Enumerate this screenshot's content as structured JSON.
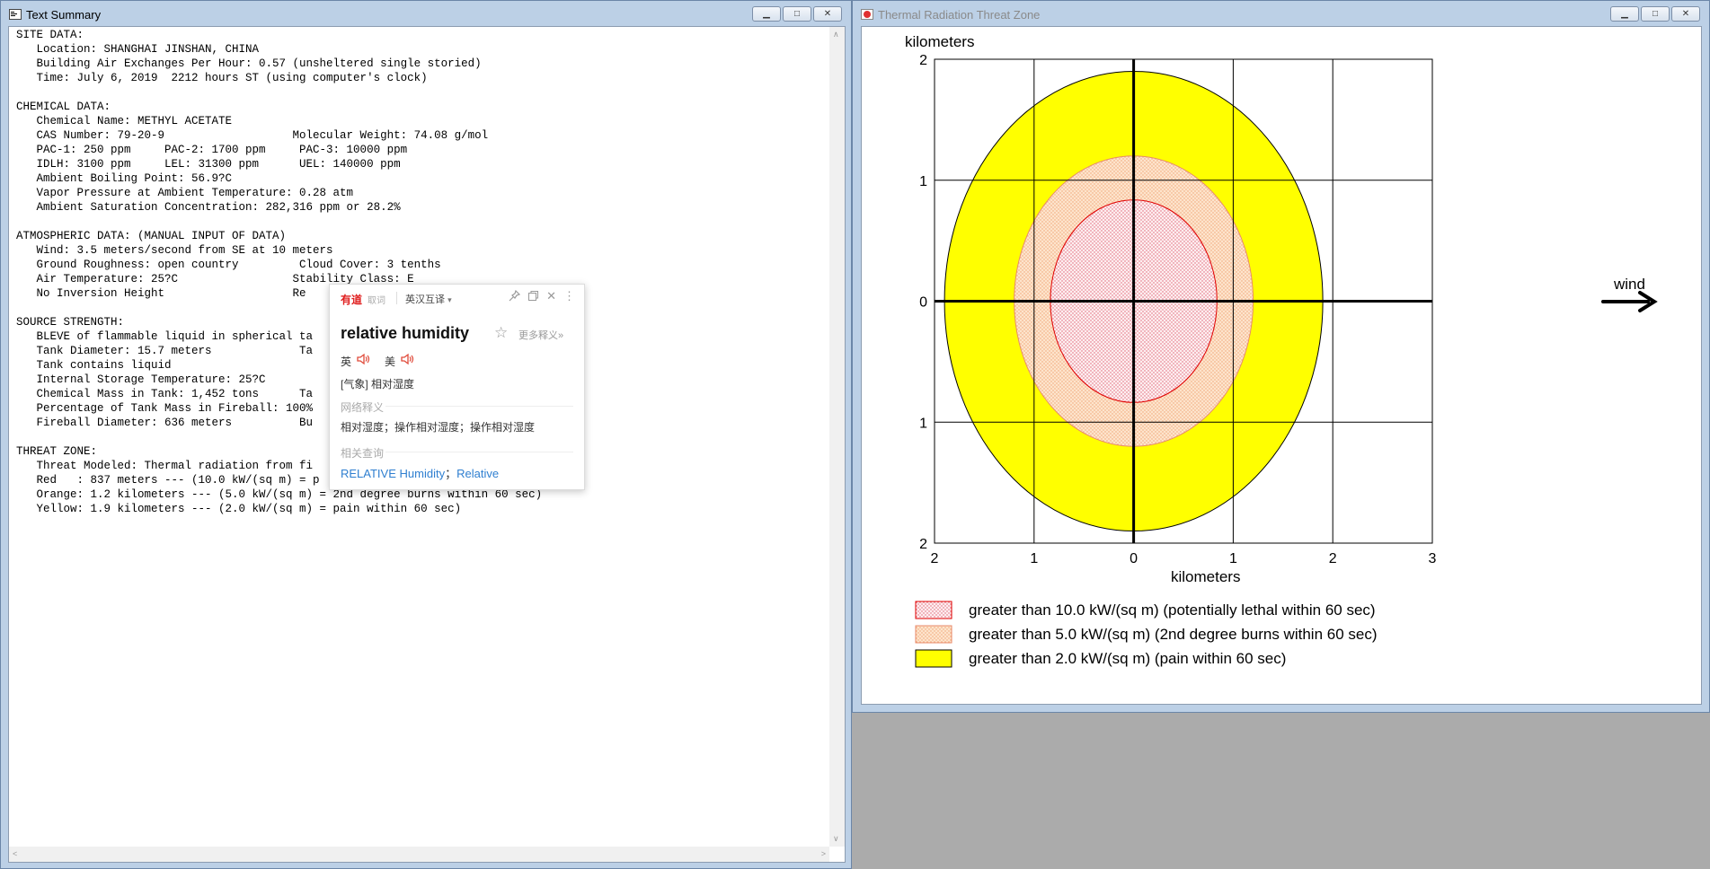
{
  "text_window": {
    "title": "Text Summary",
    "lines": [
      "SITE DATA:",
      "   Location: SHANGHAI JINSHAN, CHINA",
      "   Building Air Exchanges Per Hour: 0.57 (unsheltered single storied)",
      "   Time: July 6, 2019  2212 hours ST (using computer's clock)",
      "",
      "CHEMICAL DATA:",
      "   Chemical Name: METHYL ACETATE",
      "   CAS Number: 79-20-9                   Molecular Weight: 74.08 g/mol",
      "   PAC-1: 250 ppm     PAC-2: 1700 ppm     PAC-3: 10000 ppm",
      "   IDLH: 3100 ppm     LEL: 31300 ppm      UEL: 140000 ppm",
      "   Ambient Boiling Point: 56.9?C",
      "   Vapor Pressure at Ambient Temperature: 0.28 atm",
      "   Ambient Saturation Concentration: 282,316 ppm or 28.2%",
      "",
      "ATMOSPHERIC DATA: (MANUAL INPUT OF DATA)",
      "   Wind: 3.5 meters/second from SE at 10 meters",
      "   Ground Roughness: open country         Cloud Cover: 3 tenths",
      "   Air Temperature: 25?C                 Stability Class: E",
      "   No Inversion Height                   Re",
      "",
      "SOURCE STRENGTH:",
      "   BLEVE of flammable liquid in spherical ta",
      "   Tank Diameter: 15.7 meters             Ta",
      "   Tank contains liquid",
      "   Internal Storage Temperature: 25?C",
      "   Chemical Mass in Tank: 1,452 tons      Ta",
      "   Percentage of Tank Mass in Fireball: 100%",
      "   Fireball Diameter: 636 meters          Bu",
      "",
      "THREAT ZONE:",
      "   Threat Modeled: Thermal radiation from fi",
      "   Red   : 837 meters --- (10.0 kW/(sq m) = p",
      "   Orange: 1.2 kilometers --- (5.0 kW/(sq m) = 2nd degree burns within 60 sec)",
      "   Yellow: 1.9 kilometers --- (2.0 kW/(sq m) = pain within 60 sec)"
    ]
  },
  "dictionary_popup": {
    "brand": "有道",
    "brand_sub": "取词",
    "mode": "英汉互译",
    "word": "relative humidity",
    "more": "更多释义»",
    "phon_uk": "英",
    "phon_us": "美",
    "definition": "[气象] 相对湿度",
    "web_section": "网络释义",
    "web_meanings": "相对湿度；操作相对湿度；操作相对湿度",
    "related_section": "相关查询",
    "related_1": "RELATIVE Humidity",
    "related_sep": "；",
    "related_2": "Relative"
  },
  "threat_window": {
    "title": "Thermal Radiation Threat Zone",
    "wind_label": "wind"
  },
  "chart_data": {
    "type": "area",
    "xlabel": "kilometers",
    "ylabel": "kilometers",
    "xlim": [
      -2,
      3
    ],
    "ylim": [
      -2,
      2
    ],
    "x_ticks": [
      -2,
      -1,
      0,
      1,
      2,
      3
    ],
    "x_tick_labels": [
      "2",
      "1",
      "0",
      "1",
      "2",
      "3"
    ],
    "y_ticks": [
      -2,
      -1,
      0,
      1,
      2
    ],
    "y_tick_labels": [
      "2",
      "1",
      "0",
      "1",
      "2"
    ],
    "grid": true,
    "zones": [
      {
        "name": "greater than 2.0 kW/(sq m) (pain within 60 sec)",
        "radius_km": 1.9,
        "color": "#ffff00",
        "stroke": "#000000",
        "pattern": "solid"
      },
      {
        "name": "greater than 5.0 kW/(sq m) (2nd degree burns within 60 sec)",
        "radius_km": 1.2,
        "color": "#fbd9b8",
        "stroke": "#e88a6a",
        "pattern": "dots"
      },
      {
        "name": "greater than 10.0 kW/(sq m) (potentially lethal within 60 sec)",
        "radius_km": 0.837,
        "color": "#fde6ea",
        "stroke": "#e00000",
        "pattern": "dots"
      }
    ],
    "legend": [
      "greater than 10.0 kW/(sq m) (potentially lethal within 60 sec)",
      "greater than 5.0 kW/(sq m) (2nd degree burns within 60 sec)",
      "greater than 2.0 kW/(sq m) (pain within 60 sec)"
    ],
    "legend_position": "bottom"
  }
}
